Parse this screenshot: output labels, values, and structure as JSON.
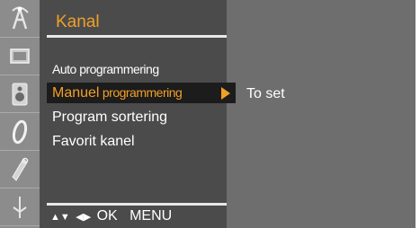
{
  "menu": {
    "title": "Kanal",
    "items": [
      {
        "label": "Auto programmering"
      },
      {
        "label_a": "Manuel",
        "label_b": " programmering"
      },
      {
        "label": "Program  sortering"
      },
      {
        "label": "Favorit kanel"
      }
    ],
    "selected_index": 1
  },
  "side_panel": {
    "hint": "To set"
  },
  "footer": {
    "updown_glyph": "▲▼",
    "leftright_glyph": "◀▶",
    "ok_label": "OK",
    "menu_label": "MENU"
  },
  "icons": [
    "antenna-icon",
    "picture-icon",
    "sound-icon",
    "time-icon",
    "special-icon",
    "screen-icon"
  ],
  "colors": {
    "accent": "#f0a028",
    "panel": "#4b4b4b",
    "selected_row": "#1c1c1c",
    "icon_bar": "#8c8c8c",
    "background": "#6e6e6e"
  }
}
